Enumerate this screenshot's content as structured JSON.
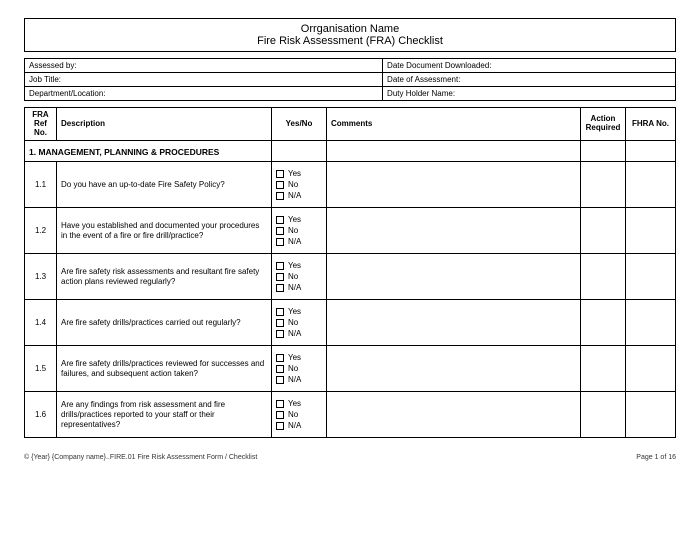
{
  "title": {
    "line1": "Orrganisation Name",
    "line2": "Fire Risk Assessment (FRA) Checklist"
  },
  "meta": {
    "assessed_by": "Assessed by:",
    "date_downloaded": "Date Document Downloaded:",
    "job_title": "Job Title:",
    "date_assessment": "Date of Assessment:",
    "dept_location": "Department/Location:",
    "duty_holder": "Duty Holder Name:"
  },
  "headers": {
    "ref": "FRA Ref No.",
    "desc": "Description",
    "yn": "Yes/No",
    "comments": "Comments",
    "action": "Action Required",
    "fhra": "FHRA No."
  },
  "options": {
    "yes": "Yes",
    "no": "No",
    "na": "N/A"
  },
  "section_title": "1. MANAGEMENT, PLANNING & PROCEDURES",
  "rows": [
    {
      "ref": "1.1",
      "desc": "Do you have an up-to-date Fire Safety Policy?"
    },
    {
      "ref": "1.2",
      "desc": "Have you established and documented your procedures in the event of a fire or fire drill/practice?"
    },
    {
      "ref": "1.3",
      "desc": "Are fire safety risk assessments and resultant fire safety action plans reviewed regularly?"
    },
    {
      "ref": "1.4",
      "desc": "Are fire safety drills/practices carried out regularly?"
    },
    {
      "ref": "1.5",
      "desc": "Are fire safety drills/practices reviewed for successes and failures, and subsequent action taken?"
    },
    {
      "ref": "1.6",
      "desc": "Are any findings from risk assessment and fire drills/practices reported to your staff or their representatives?"
    }
  ],
  "footer": {
    "left": "© {Year} {Company name}..FIRE.01 Fire Risk Assessment Form / Checklist",
    "right": "Page 1 of 16"
  }
}
